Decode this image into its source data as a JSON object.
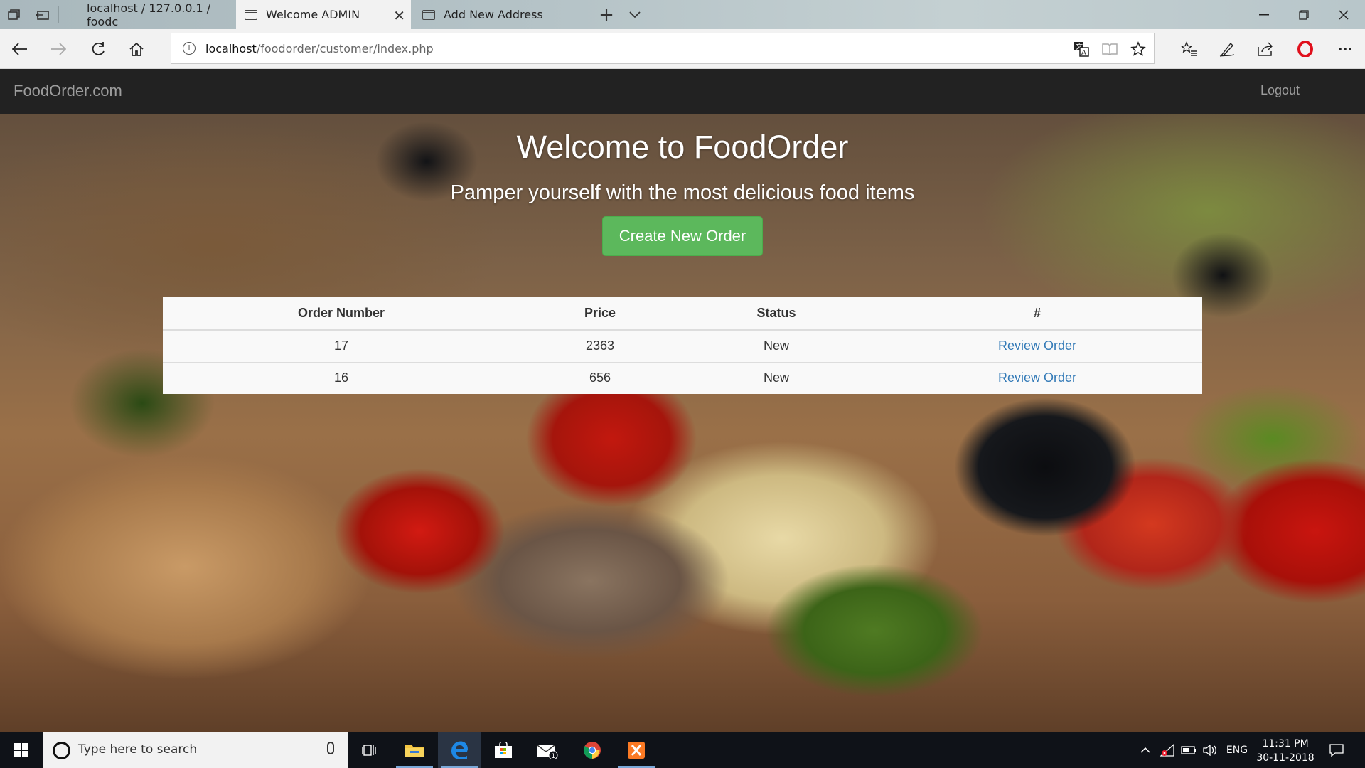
{
  "browser": {
    "tabs": [
      {
        "title": "localhost / 127.0.0.1 / foodc",
        "active": false
      },
      {
        "title": "Welcome ADMIN",
        "active": true
      },
      {
        "title": "Add New Address",
        "active": false
      }
    ],
    "url": {
      "host": "localhost",
      "path": "/foodorder/customer/index.php"
    }
  },
  "site": {
    "brand": "FoodOrder.com",
    "logout_label": "Logout",
    "hero_title": "Welcome to FoodOrder",
    "hero_subtitle": "Pamper yourself with the most delicious food items",
    "create_button_label": "Create New Order",
    "orders_table": {
      "headers": [
        "Order Number",
        "Price",
        "Status",
        "#"
      ],
      "rows": [
        {
          "order_number": "17",
          "price": "2363",
          "status": "New",
          "action": "Review Order"
        },
        {
          "order_number": "16",
          "price": "656",
          "status": "New",
          "action": "Review Order"
        }
      ]
    },
    "colors": {
      "navbar": "#222222",
      "create_button": "#5cb85c",
      "link": "#337ab7"
    }
  },
  "taskbar": {
    "search_placeholder": "Type here to search",
    "mail_badge": "1",
    "language": "ENG",
    "time": "11:31 PM",
    "date": "30-11-2018"
  }
}
